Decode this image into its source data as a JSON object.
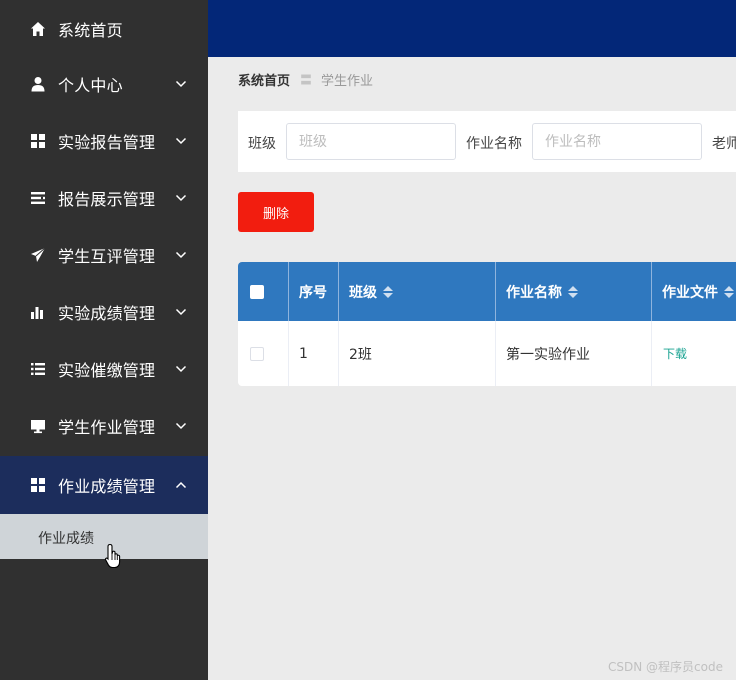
{
  "sidebar": {
    "items": [
      {
        "label": "系统首页",
        "icon": "home-icon"
      },
      {
        "label": "个人中心",
        "icon": "user-icon"
      },
      {
        "label": "实验报告管理",
        "icon": "grid-icon"
      },
      {
        "label": "报告展示管理",
        "icon": "list-icon"
      },
      {
        "label": "学生互评管理",
        "icon": "send-icon"
      },
      {
        "label": "实验成绩管理",
        "icon": "bar-chart-icon"
      },
      {
        "label": "实验催缴管理",
        "icon": "list-icon"
      },
      {
        "label": "学生作业管理",
        "icon": "monitor-icon"
      },
      {
        "label": "作业成绩管理",
        "icon": "grid-icon"
      }
    ],
    "sub_item": {
      "label": "作业成绩"
    }
  },
  "breadcrumb": {
    "home": "系统首页",
    "separator": "〓",
    "current": "学生作业"
  },
  "search": {
    "class_label": "班级",
    "class_placeholder": "班级",
    "homework_label": "作业名称",
    "homework_placeholder": "作业名称",
    "teacher_label": "老师"
  },
  "actions": {
    "delete_label": "删除"
  },
  "table": {
    "headers": {
      "index": "序号",
      "class": "班级",
      "name": "作业名称",
      "file": "作业文件"
    },
    "rows": [
      {
        "index": "1",
        "class": "2班",
        "name": "第一实验作业",
        "file": "下载"
      }
    ]
  },
  "watermark": "CSDN @程序员code",
  "colors": {
    "sidebar": "#303030",
    "topbar": "#032778",
    "active": "#1c2d5c",
    "header": "#2f78bf",
    "danger": "#f21d0f",
    "link": "#1aa392"
  }
}
